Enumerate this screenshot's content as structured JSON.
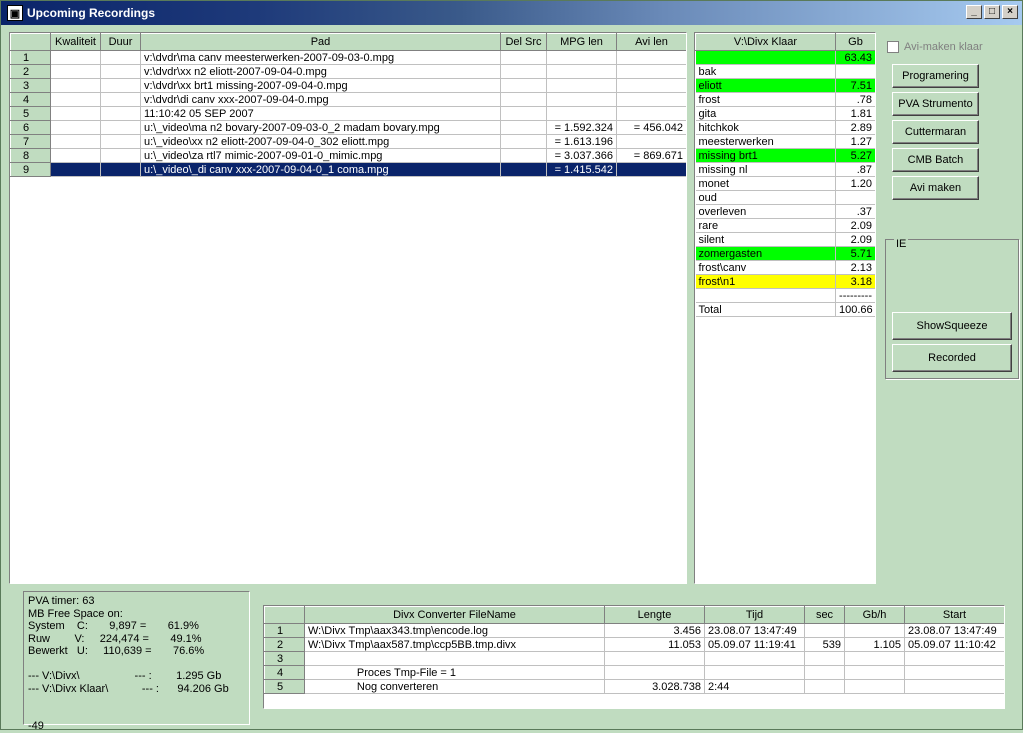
{
  "window": {
    "title": "Upcoming Recordings",
    "controls": [
      "_",
      "□",
      "×"
    ]
  },
  "recordings": {
    "columns": [
      "",
      "Kwaliteit",
      "Duur",
      "Pad",
      "Del Src",
      "MPG len",
      "Avi len"
    ],
    "rows": [
      {
        "n": "1",
        "kwaliteit": "",
        "duur": "",
        "pad": "v:\\dvdr\\ma canv meesterwerken-2007-09-03-0.mpg",
        "delsrc": "",
        "mpg": "",
        "avi": ""
      },
      {
        "n": "2",
        "kwaliteit": "",
        "duur": "",
        "pad": "v:\\dvdr\\xx n2 eliott-2007-09-04-0.mpg",
        "delsrc": "",
        "mpg": "",
        "avi": ""
      },
      {
        "n": "3",
        "kwaliteit": "",
        "duur": "",
        "pad": "v:\\dvdr\\xx brt1 missing-2007-09-04-0.mpg",
        "delsrc": "",
        "mpg": "",
        "avi": ""
      },
      {
        "n": "4",
        "kwaliteit": "",
        "duur": "",
        "pad": "v:\\dvdr\\di canv xxx-2007-09-04-0.mpg",
        "delsrc": "",
        "mpg": "",
        "avi": ""
      },
      {
        "n": "5",
        "kwaliteit": "",
        "duur": "",
        "pad": "11:10:42  05 SEP 2007",
        "delsrc": "",
        "mpg": "",
        "avi": ""
      },
      {
        "n": "6",
        "kwaliteit": "",
        "duur": "",
        "pad": "u:\\_video\\ma n2 bovary-2007-09-03-0_2 madam bovary.mpg",
        "delsrc": "",
        "mpg": "= 1.592.324",
        "avi": "= 456.042"
      },
      {
        "n": "7",
        "kwaliteit": "",
        "duur": "",
        "pad": "u:\\_video\\xx n2 eliott-2007-09-04-0_302 eliott.mpg",
        "delsrc": "",
        "mpg": "= 1.613.196",
        "avi": ""
      },
      {
        "n": "8",
        "kwaliteit": "",
        "duur": "",
        "pad": "u:\\_video\\za rtl7 mimic-2007-09-01-0_mimic.mpg",
        "delsrc": "",
        "mpg": "= 3.037.366",
        "avi": "= 869.671"
      },
      {
        "n": "9",
        "kwaliteit": "",
        "duur": "",
        "pad": "u:\\_video\\_di canv xxx-2007-09-04-0_1 coma.mpg",
        "delsrc": "",
        "mpg": "= 1.415.542",
        "avi": ""
      }
    ],
    "selected_row": "9"
  },
  "divx": {
    "columns": [
      "V:\\Divx Klaar",
      "Gb"
    ],
    "rows": [
      {
        "name": "",
        "gb": "63.43",
        "hl": "g"
      },
      {
        "name": "bak",
        "gb": "",
        "hl": ""
      },
      {
        "name": "eliott",
        "gb": "7.51",
        "hl": "g"
      },
      {
        "name": "frost",
        "gb": ".78",
        "hl": ""
      },
      {
        "name": "gita",
        "gb": "1.81",
        "hl": ""
      },
      {
        "name": "hitchkok",
        "gb": "2.89",
        "hl": ""
      },
      {
        "name": "meesterwerken",
        "gb": "1.27",
        "hl": ""
      },
      {
        "name": "missing brt1",
        "gb": "5.27",
        "hl": "g"
      },
      {
        "name": "missing nl",
        "gb": ".87",
        "hl": ""
      },
      {
        "name": "monet",
        "gb": "1.20",
        "hl": ""
      },
      {
        "name": "oud",
        "gb": "",
        "hl": ""
      },
      {
        "name": "overleven",
        "gb": ".37",
        "hl": ""
      },
      {
        "name": "rare",
        "gb": "2.09",
        "hl": ""
      },
      {
        "name": "silent",
        "gb": "2.09",
        "hl": ""
      },
      {
        "name": "zomergasten",
        "gb": "5.71",
        "hl": "g"
      },
      {
        "name": "frost\\canv",
        "gb": "2.13",
        "hl": ""
      },
      {
        "name": "frost\\n1",
        "gb": "3.18",
        "hl": "y"
      },
      {
        "name": "",
        "gb": "---------",
        "hl": ""
      },
      {
        "name": "Total",
        "gb": "100.66",
        "hl": ""
      }
    ]
  },
  "checkbox": {
    "label": "Avi-maken klaar"
  },
  "buttons": {
    "programering": "Programering",
    "pva": "PVA Strumento",
    "cutter": "Cuttermaran",
    "cmb": "CMB Batch",
    "avi": "Avi maken",
    "showsqueeze": "ShowSqueeze",
    "recorded": "Recorded"
  },
  "group": {
    "label": "IE"
  },
  "info": {
    "lines": [
      "PVA timer: 63",
      "MB Free Space on:",
      "System    C:       9,897 =       61.9%",
      "Ruw        V:     224,474 =       49.1%",
      "Bewerkt   U:     110,639 =       76.6%",
      "",
      "--- V:\\Divx\\                  --- :        1.295 Gb",
      "--- V:\\Divx Klaar\\           --- :      94.206 Gb",
      "",
      "",
      "-49"
    ]
  },
  "converter": {
    "columns": [
      "",
      "Divx Converter FileName",
      "Lengte",
      "Tijd",
      "sec",
      "Gb/h",
      "Start"
    ],
    "rows": [
      {
        "n": "1",
        "file": "W:\\Divx Tmp\\aax343.tmp\\encode.log",
        "lengte": "3.456",
        "tijd": "23.08.07 13:47:49",
        "sec": "",
        "gbh": "",
        "start": "23.08.07 13:47:49"
      },
      {
        "n": "2",
        "file": "W:\\Divx Tmp\\aax587.tmp\\ccp5BB.tmp.divx",
        "lengte": "11.053",
        "tijd": "05.09.07 11:19:41",
        "sec": "539",
        "gbh": "1.105",
        "start": "05.09.07 11:10:42"
      },
      {
        "n": "3",
        "file": "",
        "lengte": "",
        "tijd": "",
        "sec": "",
        "gbh": "",
        "start": ""
      },
      {
        "n": "4",
        "file": "                Proces Tmp-File = 1",
        "lengte": "",
        "tijd": "",
        "sec": "",
        "gbh": "",
        "start": ""
      },
      {
        "n": "5",
        "file": "                Nog converteren",
        "lengte": "3.028.738",
        "tijd": "2:44",
        "sec": "",
        "gbh": "",
        "start": ""
      }
    ]
  }
}
